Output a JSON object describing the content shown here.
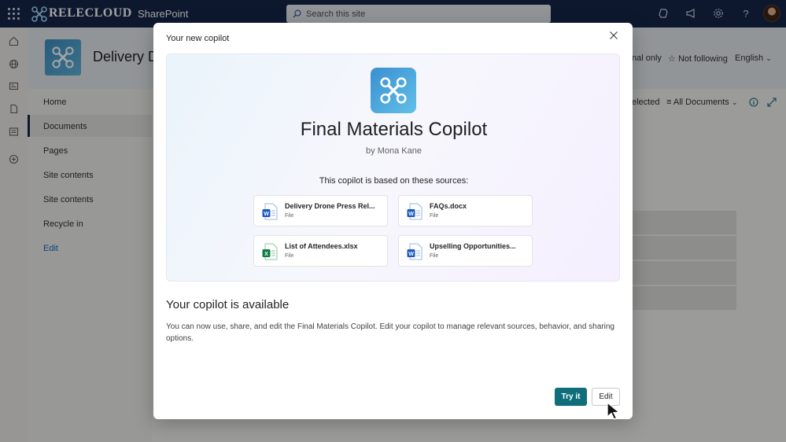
{
  "suite": {
    "brand": "RELECLOUD",
    "app": "SharePoint",
    "search_placeholder": "Search this site"
  },
  "site": {
    "title": "Delivery D",
    "internal_only": "nal only",
    "following": "Not following",
    "language": "English"
  },
  "nav": {
    "items": [
      {
        "label": "Home"
      },
      {
        "label": "Documents"
      },
      {
        "label": "Pages"
      },
      {
        "label": "Site contents"
      },
      {
        "label": "Site contents"
      },
      {
        "label": "Recycle in"
      },
      {
        "label": "Edit"
      }
    ]
  },
  "commandbar": {
    "selected": "elected",
    "view": "All Documents"
  },
  "dialog": {
    "header": "Your new copilot",
    "copilot_name": "Final Materials Copilot",
    "byline": "by Mona Kane",
    "sources_intro": "This copilot is based on these sources:",
    "files": [
      {
        "name": "Delivery Drone Press Rel...",
        "type": "File",
        "icon": "word-icon"
      },
      {
        "name": "FAQs.docx",
        "type": "File",
        "icon": "word-icon"
      },
      {
        "name": "List of Attendees.xlsx",
        "type": "File",
        "icon": "excel-icon"
      },
      {
        "name": "Upselling Opportunities...",
        "type": "File",
        "icon": "word-icon"
      }
    ],
    "available_title": "Your copilot is available",
    "available_desc": "You can now use, share, and edit the Final Materials Copilot. Edit your copilot to manage relevant sources, behavior, and sharing options.",
    "try_label": "Try it",
    "edit_label": "Edit"
  },
  "colors": {
    "suitebar": "#15264a",
    "primary_button": "#0f6e7a",
    "word": "#185abd",
    "excel": "#107c41"
  }
}
